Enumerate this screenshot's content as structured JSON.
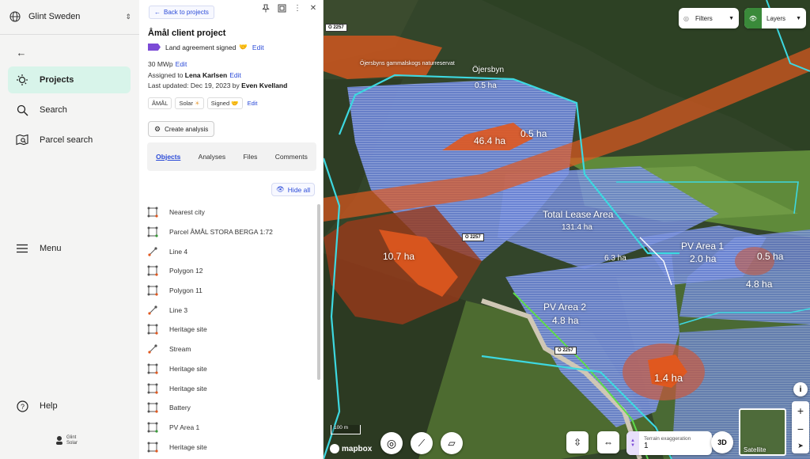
{
  "nav": {
    "org": "Glint Sweden",
    "items": [
      {
        "label": "Projects",
        "active": true
      },
      {
        "label": "Search"
      },
      {
        "label": "Parcel search"
      },
      {
        "label": "Menu"
      },
      {
        "label": "Help"
      }
    ],
    "logo_line1": "Glint",
    "logo_line2": "Solar"
  },
  "panel": {
    "back": "Back to projects",
    "title": "Åmål client project",
    "status": "Land agreement signed",
    "edit": "Edit",
    "capacity": "30 MWp",
    "assigned_prefix": "Assigned to",
    "assigned_to": "Lena Karlsen",
    "updated_prefix": "Last updated: Dec 19, 2023 by",
    "updated_by": "Even Kvelland",
    "chips": [
      "ÅMÅL",
      "Solar",
      "Signed"
    ],
    "create_analysis": "Create analysis",
    "tabs": [
      "Objects",
      "Analyses",
      "Files",
      "Comments"
    ],
    "hide_all": "Hide all",
    "objects": [
      {
        "label": "Nearest city",
        "kind": "polygon"
      },
      {
        "label": "Parcel ÅMÅL STORA BERGA 1:72",
        "kind": "polygon"
      },
      {
        "label": "Line 4",
        "kind": "line"
      },
      {
        "label": "Polygon 12",
        "kind": "polygon"
      },
      {
        "label": "Polygon 11",
        "kind": "polygon"
      },
      {
        "label": "Line 3",
        "kind": "line"
      },
      {
        "label": "Heritage site",
        "kind": "polygon"
      },
      {
        "label": "Stream",
        "kind": "line"
      },
      {
        "label": "Heritage site",
        "kind": "polygon"
      },
      {
        "label": "Heritage site",
        "kind": "polygon"
      },
      {
        "label": "Battery",
        "kind": "polygon"
      },
      {
        "label": "PV Area 1",
        "kind": "polygon"
      },
      {
        "label": "Heritage site",
        "kind": "polygon"
      }
    ]
  },
  "map": {
    "filters": "Filters",
    "layers": "Layers",
    "labels": {
      "reserve": "Öjersbyns gammalskogs naturreservat",
      "village": "Öjersbyn",
      "a1": "0.5 ha",
      "a2": "46.4 ha",
      "a3": "0.5 ha",
      "lease": "Total Lease Area",
      "lease_ha": "131.4 ha",
      "a4": "10.7 ha",
      "a5": "6.3 ha",
      "pv1": "PV Area 1",
      "pv1_ha": "2.0 ha",
      "a6": "0.5 ha",
      "a7": "4.8 ha",
      "pv2": "PV Area 2",
      "pv2_ha": "4.8 ha",
      "a8": "1.4 ha"
    },
    "road": "O 2257",
    "scale": "100 m",
    "mapbox": "mapbox",
    "terrain_label": "Terrain exaggeration",
    "terrain_value": "1",
    "btn_3d": "3D",
    "satellite": "Satellite"
  },
  "colors": {
    "accent": "#2b4bd8",
    "active_nav": "#d8f4ea",
    "tag": "#7c4bd6",
    "cyan": "#3dd8e0",
    "orange": "#e0581f",
    "blue_area": "#6a86e0"
  }
}
